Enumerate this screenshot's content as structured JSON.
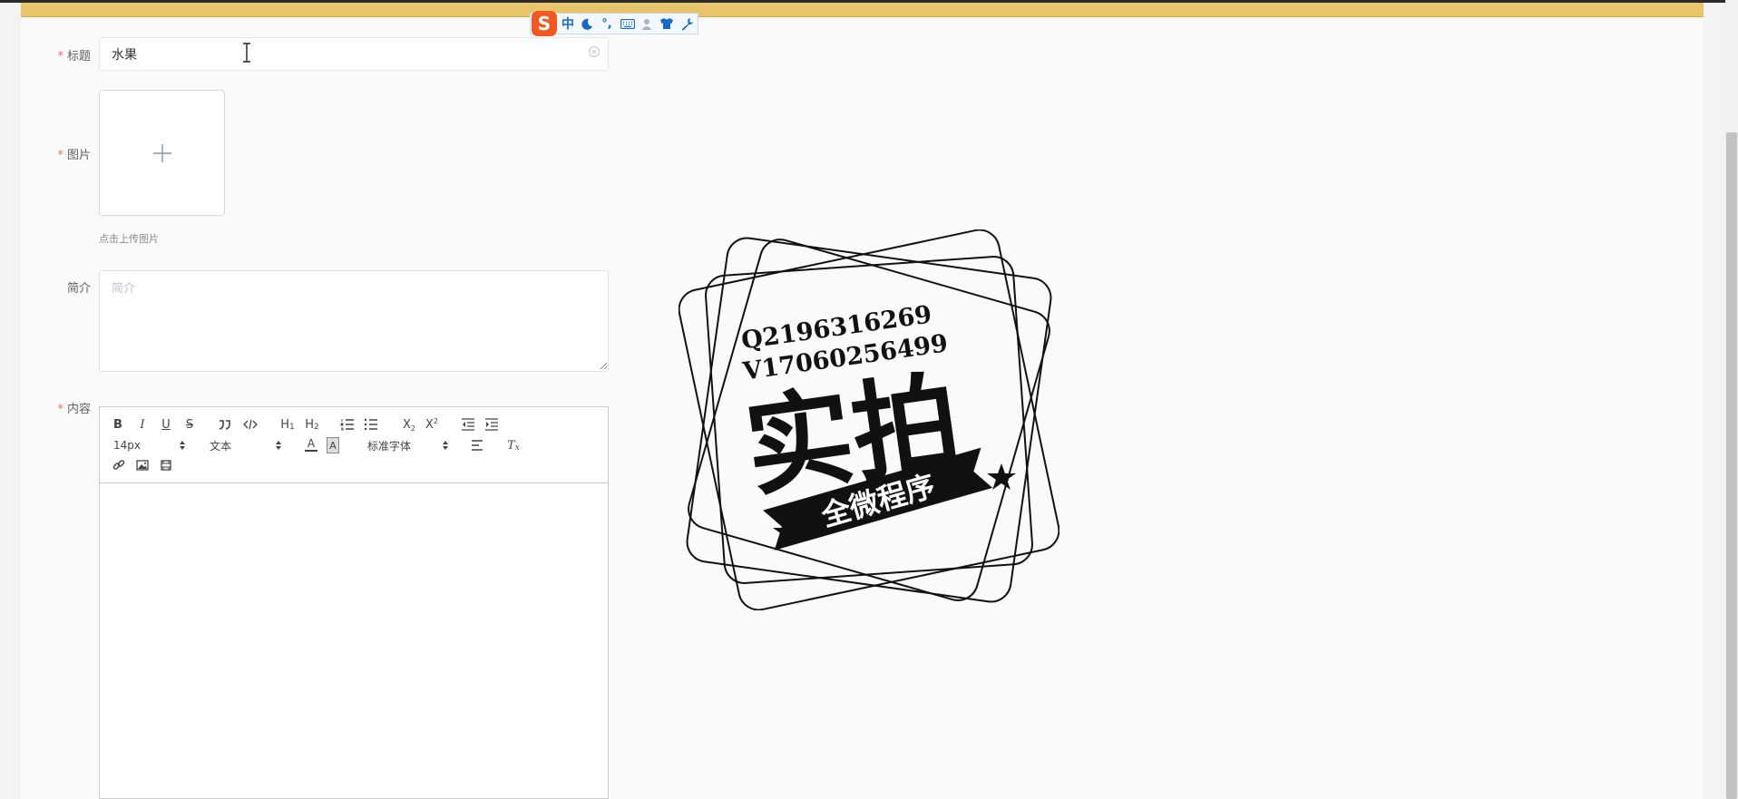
{
  "form": {
    "title_label": "标题",
    "title_value": "水果",
    "image_label": "图片",
    "upload_hint": "点击上传图片",
    "summary_label": "简介",
    "summary_placeholder": "简介",
    "content_label": "内容",
    "required_mark": "*"
  },
  "editor": {
    "font_size": "14px",
    "block_format": "文本",
    "font_family": "标准字体",
    "tools": [
      "bold",
      "italic",
      "underline",
      "strikethrough",
      "blockquote",
      "code-block",
      "header-1",
      "header-2",
      "ordered-list",
      "bullet-list",
      "subscript",
      "superscript",
      "outdent",
      "indent",
      "font-color",
      "background-color",
      "align",
      "clean-format",
      "link",
      "image",
      "video"
    ],
    "labels": {
      "bold": "B",
      "italic": "I",
      "underline": "U",
      "strike": "S",
      "h1": "H",
      "h1_sub": "1",
      "h2": "H",
      "h2_sub": "2",
      "sub": "X",
      "sub_mark": "2",
      "sup": "X",
      "sup_mark": "2",
      "color": "A",
      "bg": "A",
      "clean": "T",
      "clean_mark": "x"
    }
  },
  "ime": {
    "logo": "S",
    "mode": "中",
    "punct": "°,",
    "icons": [
      "moon-icon",
      "keyboard-icon",
      "user-icon",
      "shirt-icon",
      "wrench-icon"
    ]
  },
  "watermark": {
    "line1": "Q2196316269",
    "line2": "V17060256499",
    "main": "实拍",
    "ribbon": "全微程序"
  },
  "colors": {
    "banner": "#e8c46a",
    "required": "#f56c6c",
    "ime_blue": "#1869c7",
    "ime_logo": "#f05a22"
  }
}
